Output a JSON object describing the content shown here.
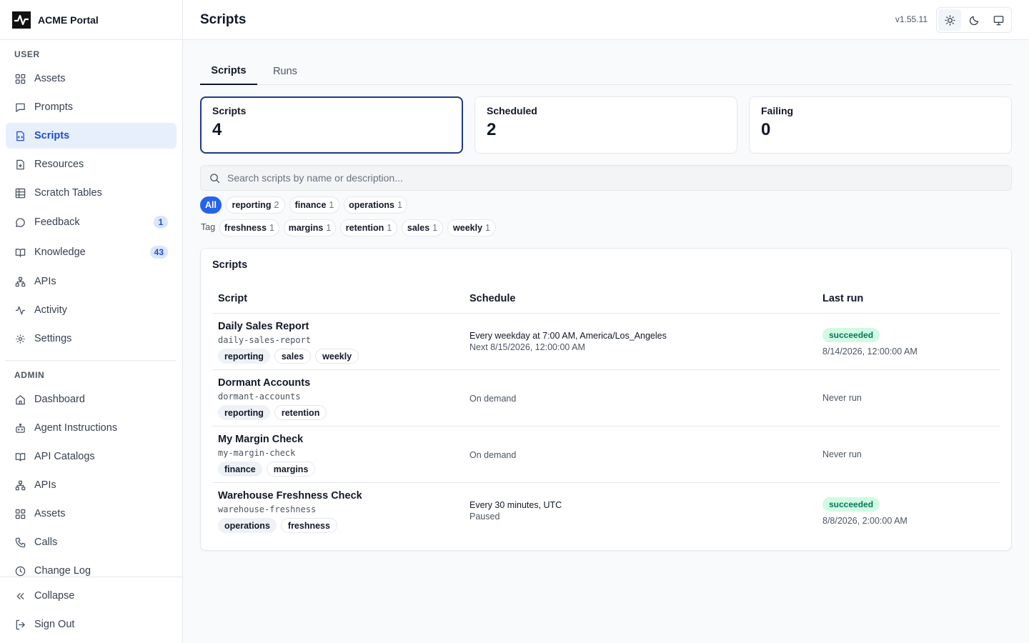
{
  "app": {
    "name": "ACME Portal",
    "version": "v1.55.11"
  },
  "sidebar": {
    "user_label": "USER",
    "user_items": [
      {
        "label": "Assets",
        "icon": "grid-icon"
      },
      {
        "label": "Prompts",
        "icon": "message-square-icon"
      },
      {
        "label": "Scripts",
        "icon": "file-code-icon",
        "active": true
      },
      {
        "label": "Resources",
        "icon": "file-plus-icon"
      },
      {
        "label": "Scratch Tables",
        "icon": "table-icon"
      },
      {
        "label": "Feedback",
        "icon": "message-circle-icon",
        "badge": "1"
      },
      {
        "label": "Knowledge",
        "icon": "book-open-icon",
        "badge": "43"
      },
      {
        "label": "APIs",
        "icon": "network-icon"
      },
      {
        "label": "Activity",
        "icon": "activity-icon"
      },
      {
        "label": "Settings",
        "icon": "gear-icon"
      }
    ],
    "admin_label": "ADMIN",
    "admin_items": [
      {
        "label": "Dashboard",
        "icon": "home-icon"
      },
      {
        "label": "Agent Instructions",
        "icon": "bot-icon"
      },
      {
        "label": "API Catalogs",
        "icon": "book-open-icon"
      },
      {
        "label": "APIs",
        "icon": "network-icon"
      },
      {
        "label": "Assets",
        "icon": "grid-icon"
      },
      {
        "label": "Calls",
        "icon": "phone-icon"
      },
      {
        "label": "Change Log",
        "icon": "clock-icon"
      }
    ],
    "collapse_label": "Collapse",
    "signout_label": "Sign Out"
  },
  "header": {
    "title": "Scripts"
  },
  "tabs": [
    {
      "label": "Scripts",
      "active": true
    },
    {
      "label": "Runs"
    }
  ],
  "stats": [
    {
      "label": "Scripts",
      "value": "4"
    },
    {
      "label": "Scheduled",
      "value": "2"
    },
    {
      "label": "Failing",
      "value": "0"
    }
  ],
  "search": {
    "placeholder": "Search scripts by name or description..."
  },
  "filters": {
    "all_label": "All",
    "categories": [
      {
        "label": "reporting",
        "count": "2"
      },
      {
        "label": "finance",
        "count": "1"
      },
      {
        "label": "operations",
        "count": "1"
      }
    ],
    "tag_label": "Tag",
    "tags": [
      {
        "label": "freshness",
        "count": "1"
      },
      {
        "label": "margins",
        "count": "1"
      },
      {
        "label": "retention",
        "count": "1"
      },
      {
        "label": "sales",
        "count": "1"
      },
      {
        "label": "weekly",
        "count": "1"
      }
    ]
  },
  "table": {
    "title": "Scripts",
    "columns": [
      "Script",
      "Schedule",
      "Last run"
    ],
    "rows": [
      {
        "name": "Daily Sales Report",
        "slug": "daily-sales-report",
        "tags": [
          {
            "label": "reporting",
            "style": "filled"
          },
          {
            "label": "sales",
            "style": "outlined"
          },
          {
            "label": "weekly",
            "style": "outlined"
          }
        ],
        "schedule": "Every weekday at 7:00 AM, America/Los_Angeles",
        "schedule_sub": "Next 8/15/2026, 12:00:00 AM",
        "status": "succeeded",
        "last_run": "8/14/2026, 12:00:00 AM"
      },
      {
        "name": "Dormant Accounts",
        "slug": "dormant-accounts",
        "tags": [
          {
            "label": "reporting",
            "style": "filled"
          },
          {
            "label": "retention",
            "style": "outlined"
          }
        ],
        "schedule": "On demand",
        "schedule_sub": "",
        "status": "",
        "last_run": "Never run"
      },
      {
        "name": "My Margin Check",
        "slug": "my-margin-check",
        "tags": [
          {
            "label": "finance",
            "style": "filled"
          },
          {
            "label": "margins",
            "style": "outlined"
          }
        ],
        "schedule": "On demand",
        "schedule_sub": "",
        "status": "",
        "last_run": "Never run"
      },
      {
        "name": "Warehouse Freshness Check",
        "slug": "warehouse-freshness",
        "tags": [
          {
            "label": "operations",
            "style": "filled"
          },
          {
            "label": "freshness",
            "style": "outlined"
          }
        ],
        "schedule": "Every 30 minutes, UTC",
        "schedule_sub": "Paused",
        "status": "succeeded",
        "last_run": "8/8/2026, 2:00:00 AM"
      }
    ]
  },
  "colors": {
    "accent": "#2563eb",
    "active_nav_bg": "#e8effc",
    "success_bg": "#d1fae5",
    "success_text": "#047857"
  }
}
